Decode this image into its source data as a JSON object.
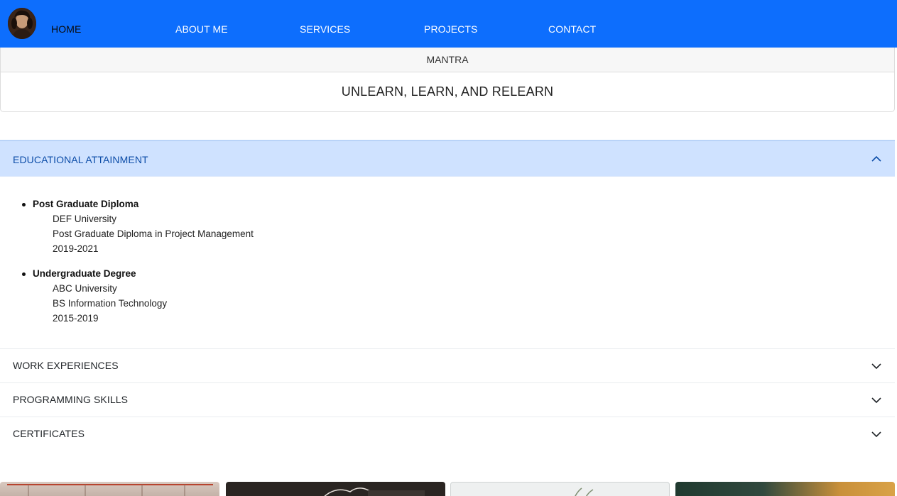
{
  "nav": {
    "items": [
      "HOME",
      "ABOUT ME",
      "SERVICES",
      "PROJECTS",
      "CONTACT"
    ],
    "active_index": 0,
    "avatar_icon": "portrait-avatar"
  },
  "mantra": {
    "header": "MANTRA",
    "text": "UNLEARN, LEARN, AND RELEARN"
  },
  "accordion": {
    "items": [
      {
        "label": "EDUCATIONAL ATTAINMENT",
        "expanded": true,
        "entries": [
          {
            "title": "Post Graduate Diploma",
            "school": "DEF University",
            "program": "Post Graduate Diploma in Project Management",
            "years": "2019-2021"
          },
          {
            "title": "Undergraduate Degree",
            "school": "ABC University",
            "program": "BS Information Technology",
            "years": "2015-2019"
          }
        ]
      },
      {
        "label": "WORK EXPERIENCES",
        "expanded": false
      },
      {
        "label": "PROGRAMMING SKILLS",
        "expanded": false
      },
      {
        "label": "CERTIFICATES",
        "expanded": false
      }
    ]
  },
  "colors": {
    "nav_bg": "#0d6efd",
    "accordion_open_bg": "#cfe2ff",
    "accordion_open_text": "#0c4da8"
  }
}
